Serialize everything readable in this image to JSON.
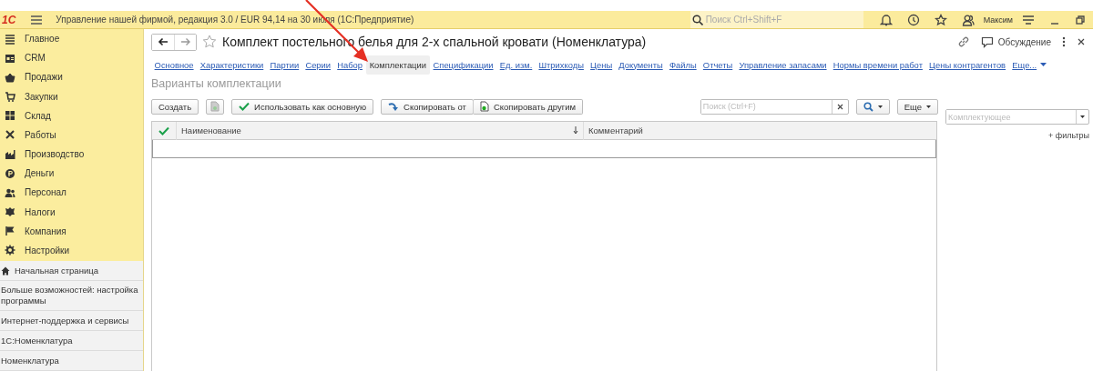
{
  "header": {
    "logo": "1С",
    "title": "Управление нашей фирмой, редакция 3.0 / EUR 94,14 на 30 июля  (1С:Предприятие)",
    "search": {
      "placeholder": "Поиск Ctrl+Shift+F"
    },
    "user": "Максим"
  },
  "sidebar": {
    "sections": [
      {
        "label": "Главное"
      },
      {
        "label": "CRM"
      },
      {
        "label": "Продажи"
      },
      {
        "label": "Закупки"
      },
      {
        "label": "Склад"
      },
      {
        "label": "Работы"
      },
      {
        "label": "Производство"
      },
      {
        "label": "Деньги"
      },
      {
        "label": "Персонал"
      },
      {
        "label": "Налоги"
      },
      {
        "label": "Компания"
      },
      {
        "label": "Настройки"
      }
    ],
    "open_windows": [
      {
        "label": "Начальная страница",
        "kind": "home"
      },
      {
        "label": "Больше возможностей: настройка программы",
        "kind": "page"
      },
      {
        "label": "Интернет-поддержка и сервисы",
        "kind": "page"
      },
      {
        "label": "1С:Номенклатура",
        "kind": "page"
      },
      {
        "label": "Номенклатура",
        "kind": "page"
      }
    ]
  },
  "form": {
    "title": "Комплект постельного белья для 2-х спальной кровати (Номенклатура)",
    "discussion": "Обсуждение",
    "tabs": [
      {
        "label": "Основное",
        "selected": false
      },
      {
        "label": "Характеристики",
        "selected": false
      },
      {
        "label": "Партии",
        "selected": false
      },
      {
        "label": "Серии",
        "selected": false
      },
      {
        "label": "Набор",
        "selected": false
      },
      {
        "label": "Комплектации",
        "selected": true
      },
      {
        "label": "Спецификации",
        "selected": false
      },
      {
        "label": "Ед. изм.",
        "selected": false
      },
      {
        "label": "Штрихкоды",
        "selected": false
      },
      {
        "label": "Цены",
        "selected": false
      },
      {
        "label": "Документы",
        "selected": false
      },
      {
        "label": "Файлы",
        "selected": false
      },
      {
        "label": "Отчеты",
        "selected": false
      },
      {
        "label": "Управление запасами",
        "selected": false
      },
      {
        "label": "Нормы времени работ",
        "selected": false
      },
      {
        "label": "Цены контрагентов",
        "selected": false
      },
      {
        "label": "Еще...",
        "selected": false
      }
    ],
    "section_title": "Варианты комплектации",
    "toolbar": {
      "create": "Создать",
      "use_main": "Использовать как основную",
      "copy_from": "Скопировать от",
      "copy_to": "Скопировать другим",
      "search": {
        "placeholder": "Поиск (Ctrl+F)"
      },
      "more": "Еще"
    },
    "table": {
      "columns": [
        {
          "label": "Наименование",
          "sorted": true
        },
        {
          "label": "Комментарий",
          "sorted": false
        }
      ]
    },
    "filter": {
      "placeholder": "Комплектующее",
      "add_filters": "+ фильтры"
    }
  }
}
